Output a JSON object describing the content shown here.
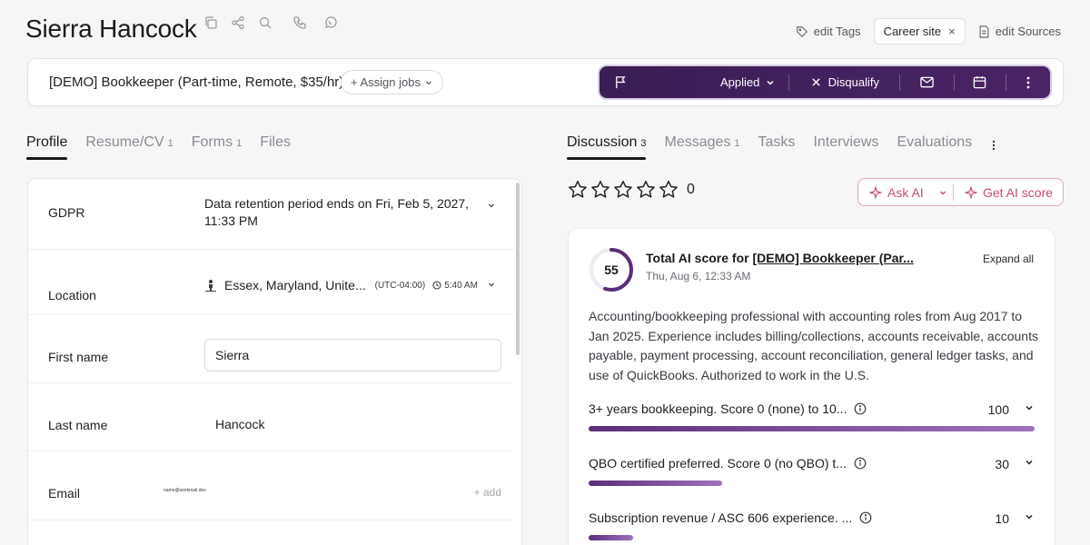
{
  "candidate": {
    "name": "Sierra Hancock"
  },
  "header_actions": {
    "edit_tags": "edit Tags",
    "career_chip": "Career site",
    "edit_sources": "edit Sources"
  },
  "job": {
    "title": "[DEMO] Bookkeeper (Part-time, Remote, $35/hr)",
    "assign_label": "+ Assign jobs",
    "stage": "Applied",
    "disqualify": "Disqualify"
  },
  "left_tabs": [
    {
      "label": "Profile",
      "count": ""
    },
    {
      "label": "Resume/CV",
      "count": "1"
    },
    {
      "label": "Forms",
      "count": "1"
    },
    {
      "label": "Files",
      "count": ""
    }
  ],
  "right_tabs": [
    {
      "label": "Discussion",
      "count": "3"
    },
    {
      "label": "Messages",
      "count": "1"
    },
    {
      "label": "Tasks",
      "count": ""
    },
    {
      "label": "Interviews",
      "count": ""
    },
    {
      "label": "Evaluations",
      "count": ""
    }
  ],
  "profile": {
    "gdpr_label": "GDPR",
    "gdpr_value": "Data retention period ends on Fri, Feb 5, 2027, 11:33 PM",
    "location_label": "Location",
    "location_value": "Essex, Maryland, Unite...",
    "timezone": "(UTC-04:00)",
    "local_time": "5:40 AM",
    "first_name_label": "First name",
    "first_name": "Sierra",
    "last_name_label": "Last name",
    "last_name": "Hancock",
    "email_label": "Email",
    "email_value": "name@workmail.dev",
    "email_add": "+ add"
  },
  "rating": {
    "value": "0",
    "stars": 5
  },
  "ai": {
    "ask_label": "Ask AI",
    "score_label": "Get AI score",
    "total_score": "55",
    "total_score_fraction": 0.55,
    "title_prefix": "Total AI score for ",
    "title_job": "[DEMO] Bookkeeper (Par...",
    "date": "Thu, Aug 6, 12:33 AM",
    "expand_all": "Expand all",
    "summary": "Accounting/bookkeeping professional with accounting roles from Aug 2017 to Jan 2025. Experience includes billing/collections, accounts receivable, accounts payable, payment processing, account reconciliation, general ledger tasks, and use of QuickBooks. Authorized to work in the U.S.",
    "criteria": [
      {
        "label": "3+ years bookkeeping. Score 0 (none) to 10...",
        "score": "100",
        "fraction": 1.0
      },
      {
        "label": "QBO certified preferred. Score 0 (no QBO) t...",
        "score": "30",
        "fraction": 0.3
      },
      {
        "label": "Subscription revenue / ASC 606 experience. ...",
        "score": "10",
        "fraction": 0.1
      }
    ]
  },
  "colors": {
    "accent_purple": "#4a2466",
    "ai_pink": "#c8497e"
  }
}
